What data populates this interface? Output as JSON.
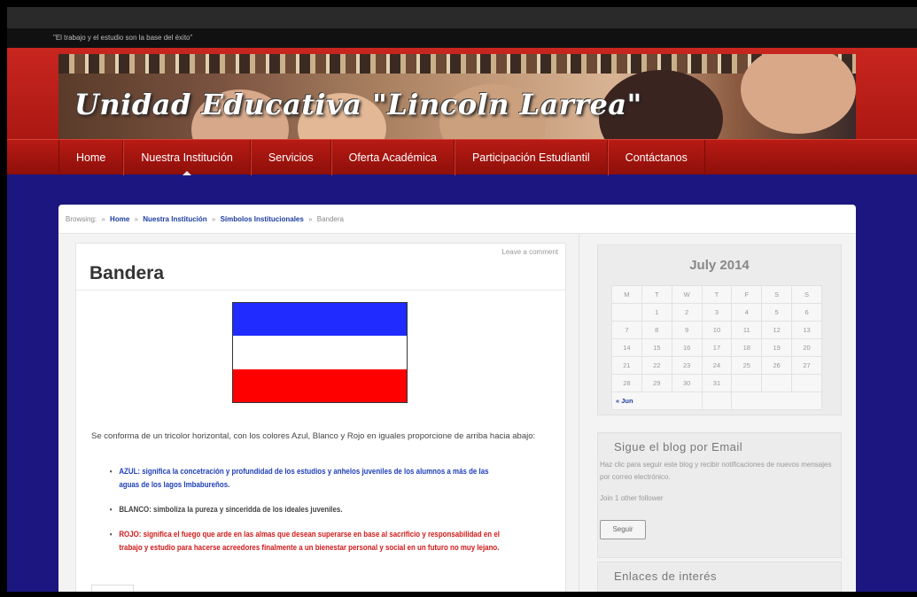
{
  "site": {
    "tagline": "\"El trabajo y el estudio son la base del éxito\"",
    "title": "Unidad Educativa \"Lincoln Larrea\"",
    "colors": {
      "header_red": "#b81b14",
      "page_bg": "#1c1780",
      "link_blue": "#1d3da0"
    }
  },
  "nav": {
    "items": [
      "Home",
      "Nuestra Institución",
      "Servicios",
      "Oferta Académica",
      "Participación Estudiantil",
      "Contáctanos"
    ],
    "active_index": 1
  },
  "breadcrumb": {
    "prefix": "Browsing:",
    "items": [
      "Home",
      "Nuestra Institución",
      "Símbolos Institucionales"
    ],
    "current": "Bandera"
  },
  "article": {
    "leave_comment": "Leave a comment",
    "title": "Bandera",
    "flag_colors": [
      "#1f2bff",
      "#ffffff",
      "#ff0000"
    ],
    "intro": "Se conforma de un tricolor horizontal, con los colores Azul, Blanco y Rojo en iguales proporcione de arriba hacia abajo:",
    "bullets": [
      "AZUL: significa la concetración y profundidad de los estudios y anhelos juveniles de los alumnos a más de las aguas de los lagos Imbabureños.",
      "BLANCO: simboliza la pureza y sinceridda de los ideales juveniles.",
      "ROJO: significa el fuego que arde en las almas que desean superarse en base al sacrificio y responsabilidad en el trabajo y estudio para hacerse acreedores finalmente a un bienestar personal y social en un futuro no muy lejano."
    ]
  },
  "calendar": {
    "title": "July 2014",
    "days": [
      "M",
      "T",
      "W",
      "T",
      "F",
      "S",
      "S"
    ],
    "weeks": [
      [
        "",
        "1",
        "2",
        "3",
        "4",
        "5",
        "6"
      ],
      [
        "7",
        "8",
        "9",
        "10",
        "11",
        "12",
        "13"
      ],
      [
        "14",
        "15",
        "16",
        "17",
        "18",
        "19",
        "20"
      ],
      [
        "21",
        "22",
        "23",
        "24",
        "25",
        "26",
        "27"
      ],
      [
        "28",
        "29",
        "30",
        "31",
        "",
        "",
        ""
      ]
    ],
    "prev_link": "« Jun"
  },
  "email_widget": {
    "title": "Sigue el blog por Email",
    "description": "Haz clic para seguir este blog y recibir notificaciones de nuevos mensajes por correo electrónico.",
    "followers": "Join 1 other follower",
    "button": "Seguir"
  },
  "links_widget": {
    "title": "Enlaces de interés"
  }
}
